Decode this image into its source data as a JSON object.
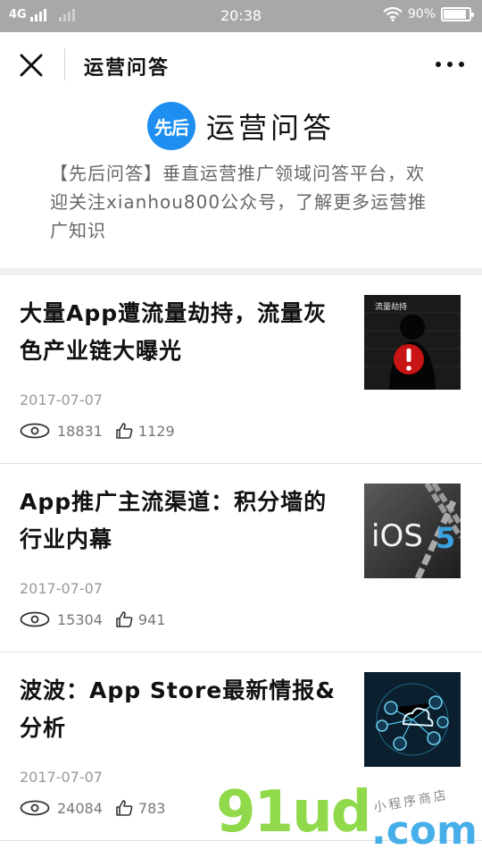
{
  "status_bar": {
    "network": "4G",
    "time": "20:38",
    "battery": "90%",
    "battery_level": 0.9
  },
  "nav": {
    "title": "运营问答"
  },
  "profile": {
    "logo_text": "先后",
    "name": "运营问答",
    "description": "【先后问答】垂直运营推广领域问答平台，欢迎关注xianhou800公众号，了解更多运营推广知识"
  },
  "articles": [
    {
      "title": "大量App遭流量劫持，流量灰色产业链大曝光",
      "date": "2017-07-07",
      "views": "18831",
      "likes": "1129"
    },
    {
      "title": "App推广主流渠道：积分墙的行业内幕",
      "date": "2017-07-07",
      "views": "15304",
      "likes": "941"
    },
    {
      "title": "波波：App Store最新情报&分析",
      "date": "2017-07-07",
      "views": "24084",
      "likes": "783"
    }
  ],
  "thumbnails": {
    "thumb1_text": "流量劫持",
    "thumb2_text": "iOS",
    "thumb2_num": "5"
  },
  "watermark": {
    "main": "91ud",
    "suffix": ".com",
    "sub": "小程序商店"
  }
}
